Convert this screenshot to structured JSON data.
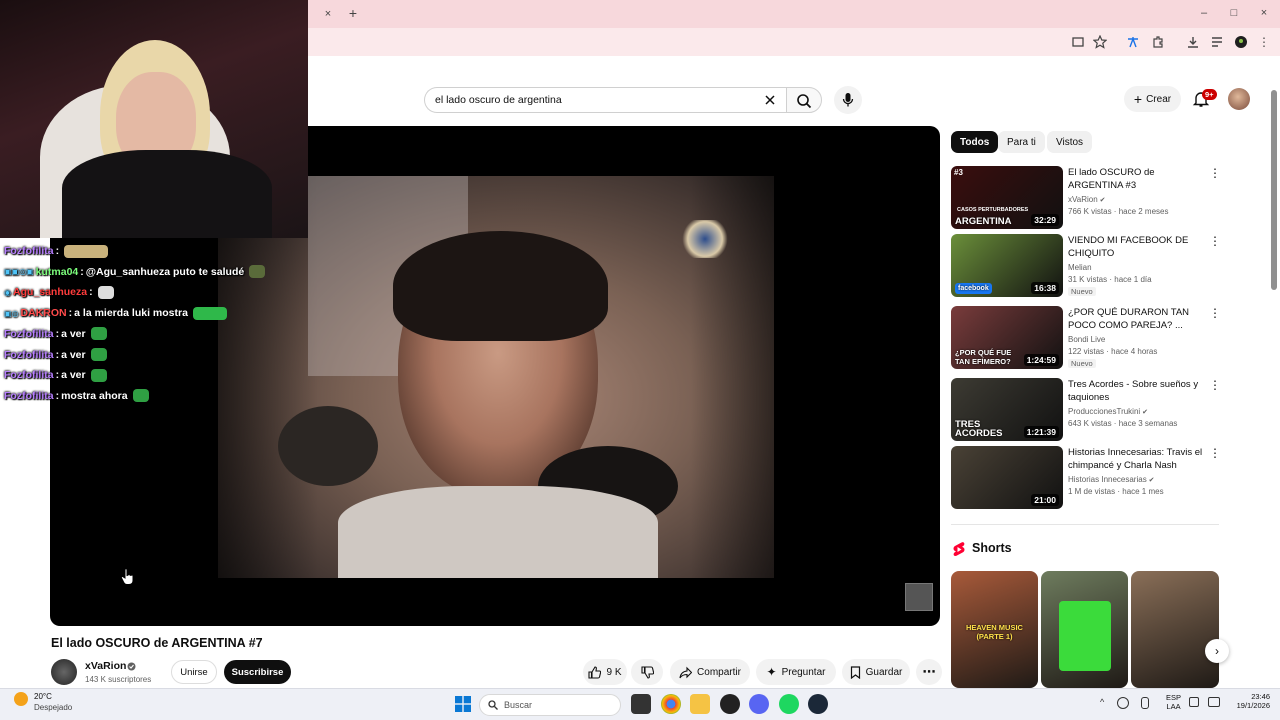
{
  "browser": {
    "new_tab_symbol": "+",
    "close_tab_symbol": "×",
    "window_controls": [
      "–",
      "□",
      "×"
    ]
  },
  "youtube": {
    "search": {
      "value": "el lado oscuro de argentina"
    },
    "header": {
      "create_label": "Crear",
      "notifications_badge": "9+"
    },
    "video": {
      "title": "El lado OSCURO de ARGENTINA #7",
      "channel": "xVaRion",
      "subscribers": "143 K suscriptores",
      "join_label": "Unirse",
      "subscribe_label": "Suscribirse",
      "likes": "9 K",
      "share_label": "Compartir",
      "ask_label": "Preguntar",
      "save_label": "Guardar"
    },
    "chips": [
      "Todos",
      "Para ti",
      "Vistos"
    ],
    "recommendations": [
      {
        "title": "El lado OSCURO de ARGENTINA #3",
        "channel": "xVaRion",
        "verified": true,
        "meta": "766 K vistas · hace 2 meses",
        "duration": "32:29",
        "badge": "",
        "thumb_label": "#3",
        "thumb_text": "ARGENTINA",
        "thumb_sub": "CASOS PERTURBADORES",
        "color": "#3a0d0d"
      },
      {
        "title": "VIENDO MI FACEBOOK DE CHIQUITO",
        "channel": "Melian",
        "verified": false,
        "meta": "31 K vistas · hace 1 día",
        "duration": "16:38",
        "badge": "Nuevo",
        "thumb_label": "",
        "thumb_text": "facebook",
        "thumb_sub": "",
        "color": "#6b8f3a"
      },
      {
        "title": "¿POR QUÉ DURARON TAN POCO COMO PAREJA? ...",
        "channel": "Bondi Live",
        "verified": false,
        "meta": "122 vistas · hace 4 horas",
        "duration": "1:24:59",
        "badge": "Nuevo",
        "thumb_label": "",
        "thumb_text": "¿POR QUÉ FUE TAN EFÍMERO?",
        "thumb_sub": "",
        "color": "#7a3c3c"
      },
      {
        "title": "Tres Acordes - Sobre sueños y taquiones",
        "channel": "ProduccionesTrukini",
        "verified": true,
        "meta": "643 K vistas · hace 3 semanas",
        "duration": "1:21:39",
        "badge": "",
        "thumb_label": "",
        "thumb_text": "TRES ACORDES",
        "thumb_sub": "",
        "color": "#3d3b33"
      },
      {
        "title": "Historias Innecesarias: Travis el chimpancé y Charla Nash",
        "channel": "Historias Innecesarias",
        "verified": true,
        "meta": "1 M de vistas · hace 1 mes",
        "duration": "21:00",
        "badge": "",
        "thumb_label": "",
        "thumb_text": "",
        "thumb_sub": "",
        "color": "#4a4236"
      }
    ],
    "shorts": {
      "title": "Shorts",
      "items": [
        {
          "text": "HEAVEN MUSIC (PARTE 1)",
          "color": "#a85a3a"
        },
        {
          "text": "",
          "color": "#6e7c5e"
        },
        {
          "text": "",
          "color": "#8a6f58"
        }
      ]
    }
  },
  "chat": [
    {
      "user": "Fozfofilita",
      "user_color": "#b77fff",
      "message": "",
      "emote": "#c9b27c",
      "badges": ""
    },
    {
      "user": "kutma04",
      "user_color": "#7dff7d",
      "message": "@Agu_sanhueza puto te saludé",
      "emote": "#5a6b3a",
      "badges": "▣▣◎▣"
    },
    {
      "user": "Agu_sanhueza",
      "user_color": "#ff3c3c",
      "message": "",
      "emote": "#dddddd",
      "badges": "◉"
    },
    {
      "user": "DAKRON",
      "user_color": "#ff4b4b",
      "message": "a la mierda luki mostra",
      "emote": "#2fb84a",
      "badges": "▣◎"
    },
    {
      "user": "Fozfofilita",
      "user_color": "#b77fff",
      "message": "a ver",
      "emote": "#2fa043",
      "badges": ""
    },
    {
      "user": "Fozfofilita",
      "user_color": "#b77fff",
      "message": "a ver",
      "emote": "#2fa043",
      "badges": ""
    },
    {
      "user": "Fozfofilita",
      "user_color": "#b77fff",
      "message": "a ver",
      "emote": "#2fa043",
      "badges": ""
    },
    {
      "user": "Fozfofilita",
      "user_color": "#b77fff",
      "message": "mostra ahora",
      "emote": "#2fa043",
      "badges": ""
    }
  ],
  "taskbar": {
    "weather_temp": "20°C",
    "weather_desc": "Despejado",
    "search_placeholder": "Buscar",
    "lang_1": "ESP",
    "lang_2": "LAA",
    "time": "23:46",
    "date": "19/1/2026"
  }
}
